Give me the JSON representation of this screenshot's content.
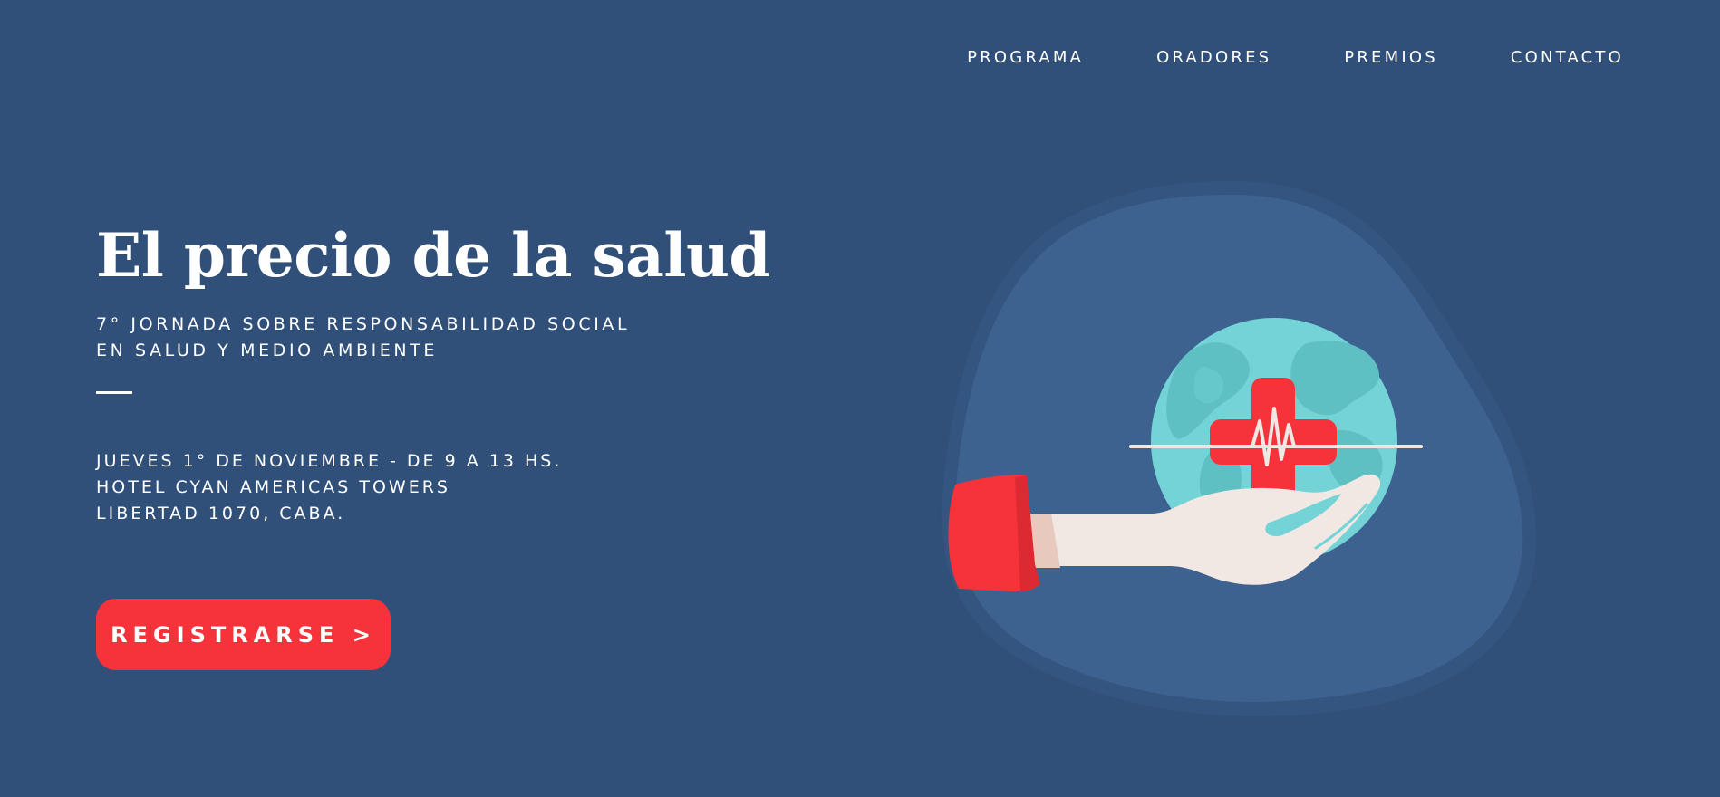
{
  "nav": {
    "items": [
      {
        "label": "PROGRAMA"
      },
      {
        "label": "ORADORES"
      },
      {
        "label": "PREMIOS"
      },
      {
        "label": "CONTACTO"
      }
    ]
  },
  "hero": {
    "title": "El precio de la salud",
    "subtitle_line1": "7° JORNADA SOBRE RESPONSABILIDAD SOCIAL",
    "subtitle_line2": "EN SALUD Y MEDIO AMBIENTE",
    "date_line": "JUEVES 1° DE NOVIEMBRE - DE 9 A 13 HS.",
    "venue_line": "HOTEL CYAN AMERICAS TOWERS",
    "address_line": "LIBERTAD 1070, CABA.",
    "cta_label": "REGISTRARSE >"
  },
  "colors": {
    "background": "#305079",
    "accent": "#f6333b",
    "blob": "#3d6290",
    "globe": "#73d3d6",
    "hand": "#f1e8e3"
  },
  "illustration": {
    "icons": [
      "globe-icon",
      "medical-cross-icon",
      "heartbeat-line-icon",
      "hand-icon"
    ]
  }
}
